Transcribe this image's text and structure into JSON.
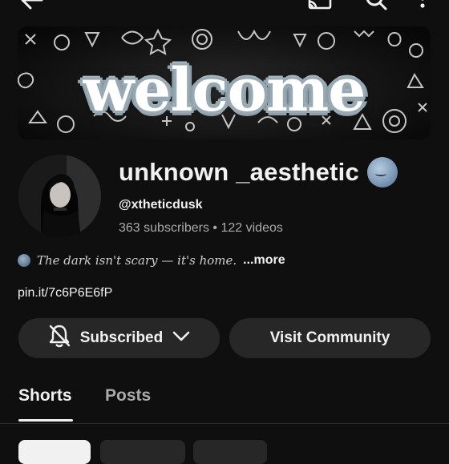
{
  "topbar": {
    "back_icon": "arrow-left-icon",
    "cast_icon": "cast-icon",
    "search_icon": "search-icon",
    "menu_icon": "more-vert-icon"
  },
  "banner": {
    "text": "welcome"
  },
  "channel": {
    "name": "unknown _aesthetic",
    "name_emoji": "new-moon-face-emoji",
    "handle": "@xtheticdusk",
    "subscribers": "363 subscribers",
    "separator": "•",
    "videos": "122 videos",
    "description": "The dark isn't scary — it's home.",
    "more_label": "...more",
    "link": "pin.it/7c6P6E6fP"
  },
  "actions": {
    "subscribed_label": "Subscribed",
    "visit_community_label": "Visit Community"
  },
  "tabs": [
    {
      "label": "Shorts",
      "active": true
    },
    {
      "label": "Posts",
      "active": false
    }
  ],
  "colors": {
    "background": "#0f0f0f",
    "button_bg": "#272727",
    "text_primary": "#f1f1f1",
    "text_secondary": "#aaaaaa"
  }
}
